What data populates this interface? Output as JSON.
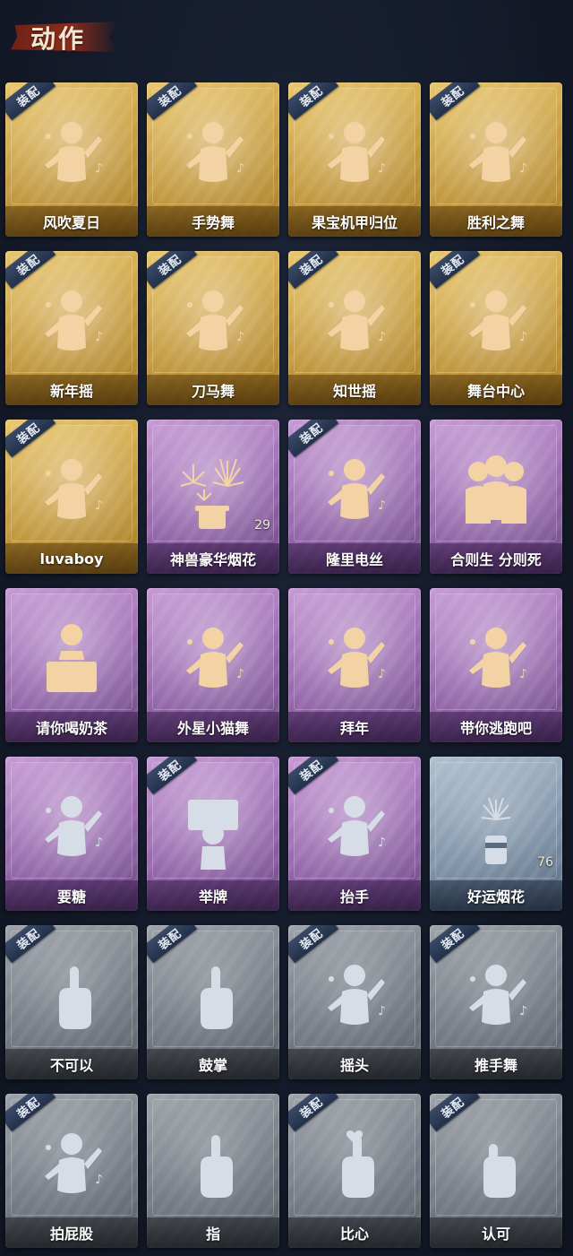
{
  "header": {
    "title": "动作"
  },
  "colors": {
    "gold": "#caa043",
    "purple": "#9a6bb0",
    "blue": "#7f93a8",
    "gray": "#777d86",
    "figure_gold": "#f3d3a4",
    "figure_silver": "#d7dde6"
  },
  "badge_text": "装配",
  "cards": [
    {
      "label": "风吹夏日",
      "tier": "gold",
      "equipped": true,
      "icon": "dancer-headset-icon"
    },
    {
      "label": "手势舞",
      "tier": "gold",
      "equipped": true,
      "icon": "dancer-gesture-icon"
    },
    {
      "label": "果宝机甲归位",
      "tier": "gold",
      "equipped": true,
      "icon": "dancer-armor-icon"
    },
    {
      "label": "胜利之舞",
      "tier": "gold",
      "equipped": true,
      "icon": "dancer-victory-icon"
    },
    {
      "label": "新年摇",
      "tier": "gold",
      "equipped": true,
      "icon": "dancer-newyear-icon"
    },
    {
      "label": "刀马舞",
      "tier": "gold",
      "equipped": true,
      "icon": "dancer-blade-icon"
    },
    {
      "label": "知世摇",
      "tier": "gold",
      "equipped": true,
      "icon": "dancer-sway-icon"
    },
    {
      "label": "舞台中心",
      "tier": "gold",
      "equipped": true,
      "icon": "dancer-stage-icon"
    },
    {
      "label": "luvaboy",
      "tier": "gold",
      "equipped": true,
      "icon": "dancer-luvaboy-icon"
    },
    {
      "label": "神兽豪华烟花",
      "tier": "purple",
      "equipped": false,
      "icon": "fireworks-deluxe-icon",
      "count": "29"
    },
    {
      "label": "隆里电丝",
      "tier": "purple",
      "equipped": true,
      "icon": "dancer-electric-icon"
    },
    {
      "label": "合则生 分则死",
      "tier": "purple",
      "equipped": false,
      "icon": "group-three-icon"
    },
    {
      "label": "请你喝奶茶",
      "tier": "purple",
      "equipped": false,
      "icon": "milk-tea-sign-icon"
    },
    {
      "label": "外星小猫舞",
      "tier": "purple",
      "equipped": false,
      "icon": "dancer-alien-cat-icon"
    },
    {
      "label": "拜年",
      "tier": "purple",
      "equipped": false,
      "icon": "dancer-bow-icon"
    },
    {
      "label": "带你逃跑吧",
      "tier": "purple",
      "equipped": false,
      "icon": "dancer-point-icon"
    },
    {
      "label": "要糖",
      "tier": "purple",
      "equipped": false,
      "icon": "dancer-candy-icon"
    },
    {
      "label": "举牌",
      "tier": "purple",
      "equipped": true,
      "icon": "hold-sign-icon"
    },
    {
      "label": "抬手",
      "tier": "purple",
      "equipped": true,
      "icon": "raise-hand-icon"
    },
    {
      "label": "好运烟花",
      "tier": "blue",
      "equipped": false,
      "icon": "firework-can-icon",
      "count": "76"
    },
    {
      "label": "不可以",
      "tier": "gray",
      "equipped": true,
      "icon": "finger-wag-icon"
    },
    {
      "label": "鼓掌",
      "tier": "gray",
      "equipped": true,
      "icon": "clap-icon"
    },
    {
      "label": "摇头",
      "tier": "gray",
      "equipped": true,
      "icon": "shake-head-icon"
    },
    {
      "label": "推手舞",
      "tier": "gray",
      "equipped": true,
      "icon": "push-hands-icon"
    },
    {
      "label": "拍屁股",
      "tier": "gray",
      "equipped": true,
      "icon": "slap-butt-icon"
    },
    {
      "label": "指",
      "tier": "gray",
      "equipped": false,
      "icon": "point-finger-icon"
    },
    {
      "label": "比心",
      "tier": "gray",
      "equipped": true,
      "icon": "finger-heart-icon"
    },
    {
      "label": "认可",
      "tier": "gray",
      "equipped": true,
      "icon": "thumbs-up-icon"
    }
  ]
}
